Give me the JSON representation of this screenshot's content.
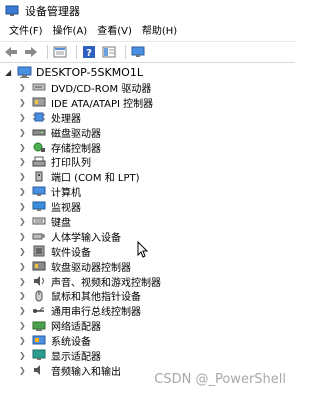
{
  "window": {
    "title": "设备管理器"
  },
  "menu": [
    "文件(F)",
    "操作(A)",
    "查看(V)",
    "帮助(H)"
  ],
  "toolbar": [
    "back-icon",
    "forward-icon",
    "properties-icon",
    "help-icon",
    "view-icon",
    "monitor-icon"
  ],
  "tree": {
    "root_label": "DESKTOP-5SKMO1L",
    "items": [
      {
        "label": "DVD/CD-ROM 驱动器",
        "icon": "dvd-drive-icon"
      },
      {
        "label": "IDE ATA/ATAPI 控制器",
        "icon": "ide-controller-icon"
      },
      {
        "label": "处理器",
        "icon": "processor-icon"
      },
      {
        "label": "磁盘驱动器",
        "icon": "disk-drive-icon"
      },
      {
        "label": "存储控制器",
        "icon": "storage-controller-icon"
      },
      {
        "label": "打印队列",
        "icon": "print-queue-icon"
      },
      {
        "label": "端口 (COM 和 LPT)",
        "icon": "port-icon"
      },
      {
        "label": "计算机",
        "icon": "computer-icon"
      },
      {
        "label": "监视器",
        "icon": "monitor-icon"
      },
      {
        "label": "键盘",
        "icon": "keyboard-icon"
      },
      {
        "label": "人体学输入设备",
        "icon": "hid-icon"
      },
      {
        "label": "软件设备",
        "icon": "software-device-icon"
      },
      {
        "label": "软盘驱动器控制器",
        "icon": "floppy-controller-icon"
      },
      {
        "label": "声音、视频和游戏控制器",
        "icon": "sound-icon"
      },
      {
        "label": "鼠标和其他指针设备",
        "icon": "mouse-icon"
      },
      {
        "label": "通用串行总线控制器",
        "icon": "usb-icon"
      },
      {
        "label": "网络适配器",
        "icon": "network-adapter-icon"
      },
      {
        "label": "系统设备",
        "icon": "system-device-icon"
      },
      {
        "label": "显示适配器",
        "icon": "display-adapter-icon"
      },
      {
        "label": "音频输入和输出",
        "icon": "audio-io-icon"
      }
    ]
  },
  "watermark": "CSDN @_PowerShell"
}
